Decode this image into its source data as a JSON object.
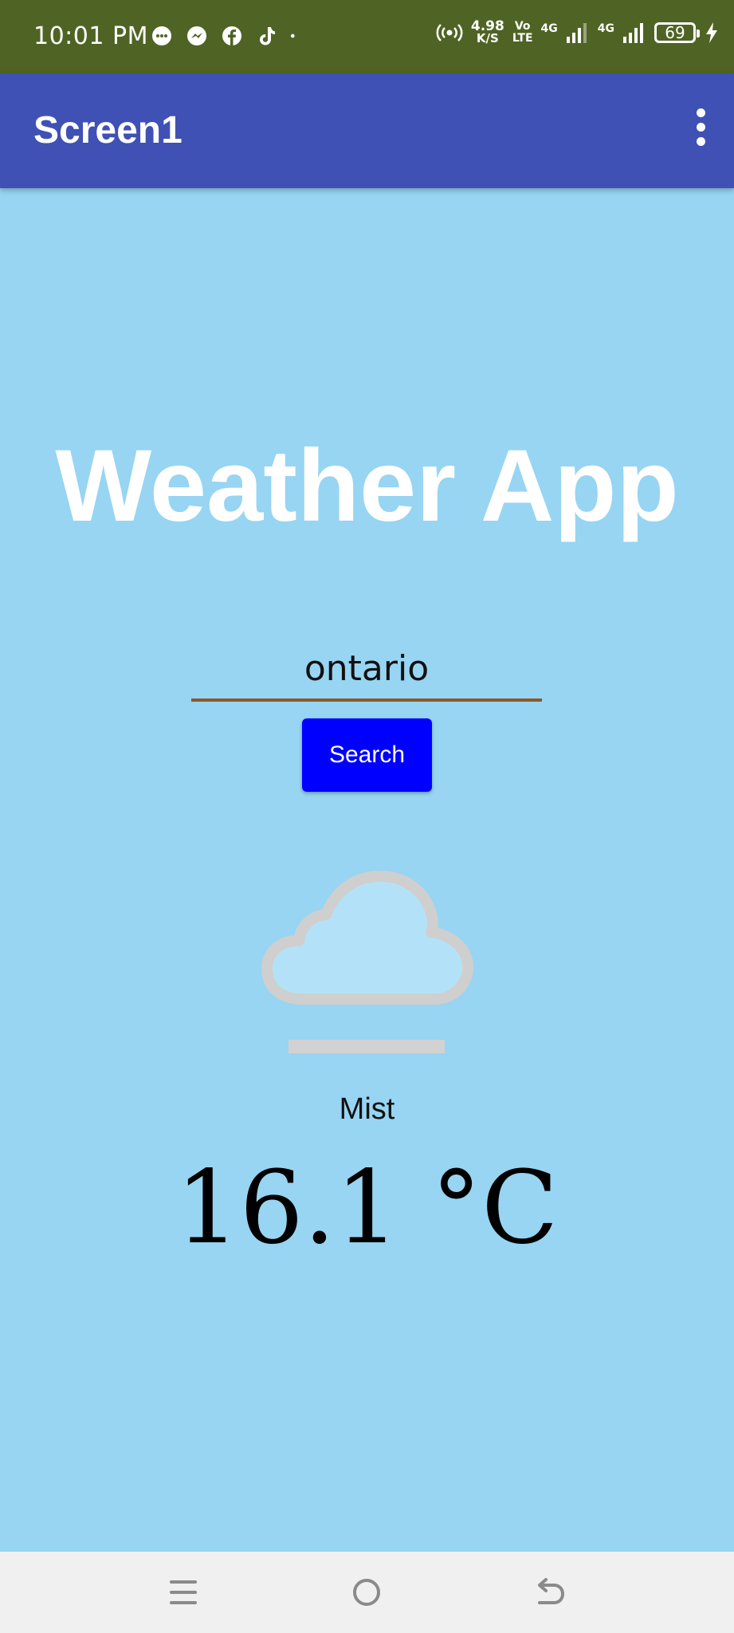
{
  "status_bar": {
    "time": "10:01 PM",
    "net_speed_value": "4.98",
    "net_speed_unit": "K/S",
    "volte_top": "Vo",
    "volte_bottom": "LTE",
    "sim1_label": "4G",
    "sim2_label": "4G",
    "battery_level": "69",
    "notification_icons": [
      "chat-bubble-icon",
      "messenger-icon",
      "facebook-icon",
      "tiktok-icon",
      "dot-icon"
    ]
  },
  "app_bar": {
    "title": "Screen1"
  },
  "main": {
    "heading": "Weather App",
    "city_input_value": "ontario",
    "search_label": "Search",
    "condition": "Mist",
    "temperature": "16.1 °C"
  },
  "colors": {
    "status_bar": "#4f6424",
    "app_bar": "#3f51b5",
    "background": "#97d5f2",
    "search_button": "#0000ff",
    "input_underline": "#8a5a2b"
  }
}
